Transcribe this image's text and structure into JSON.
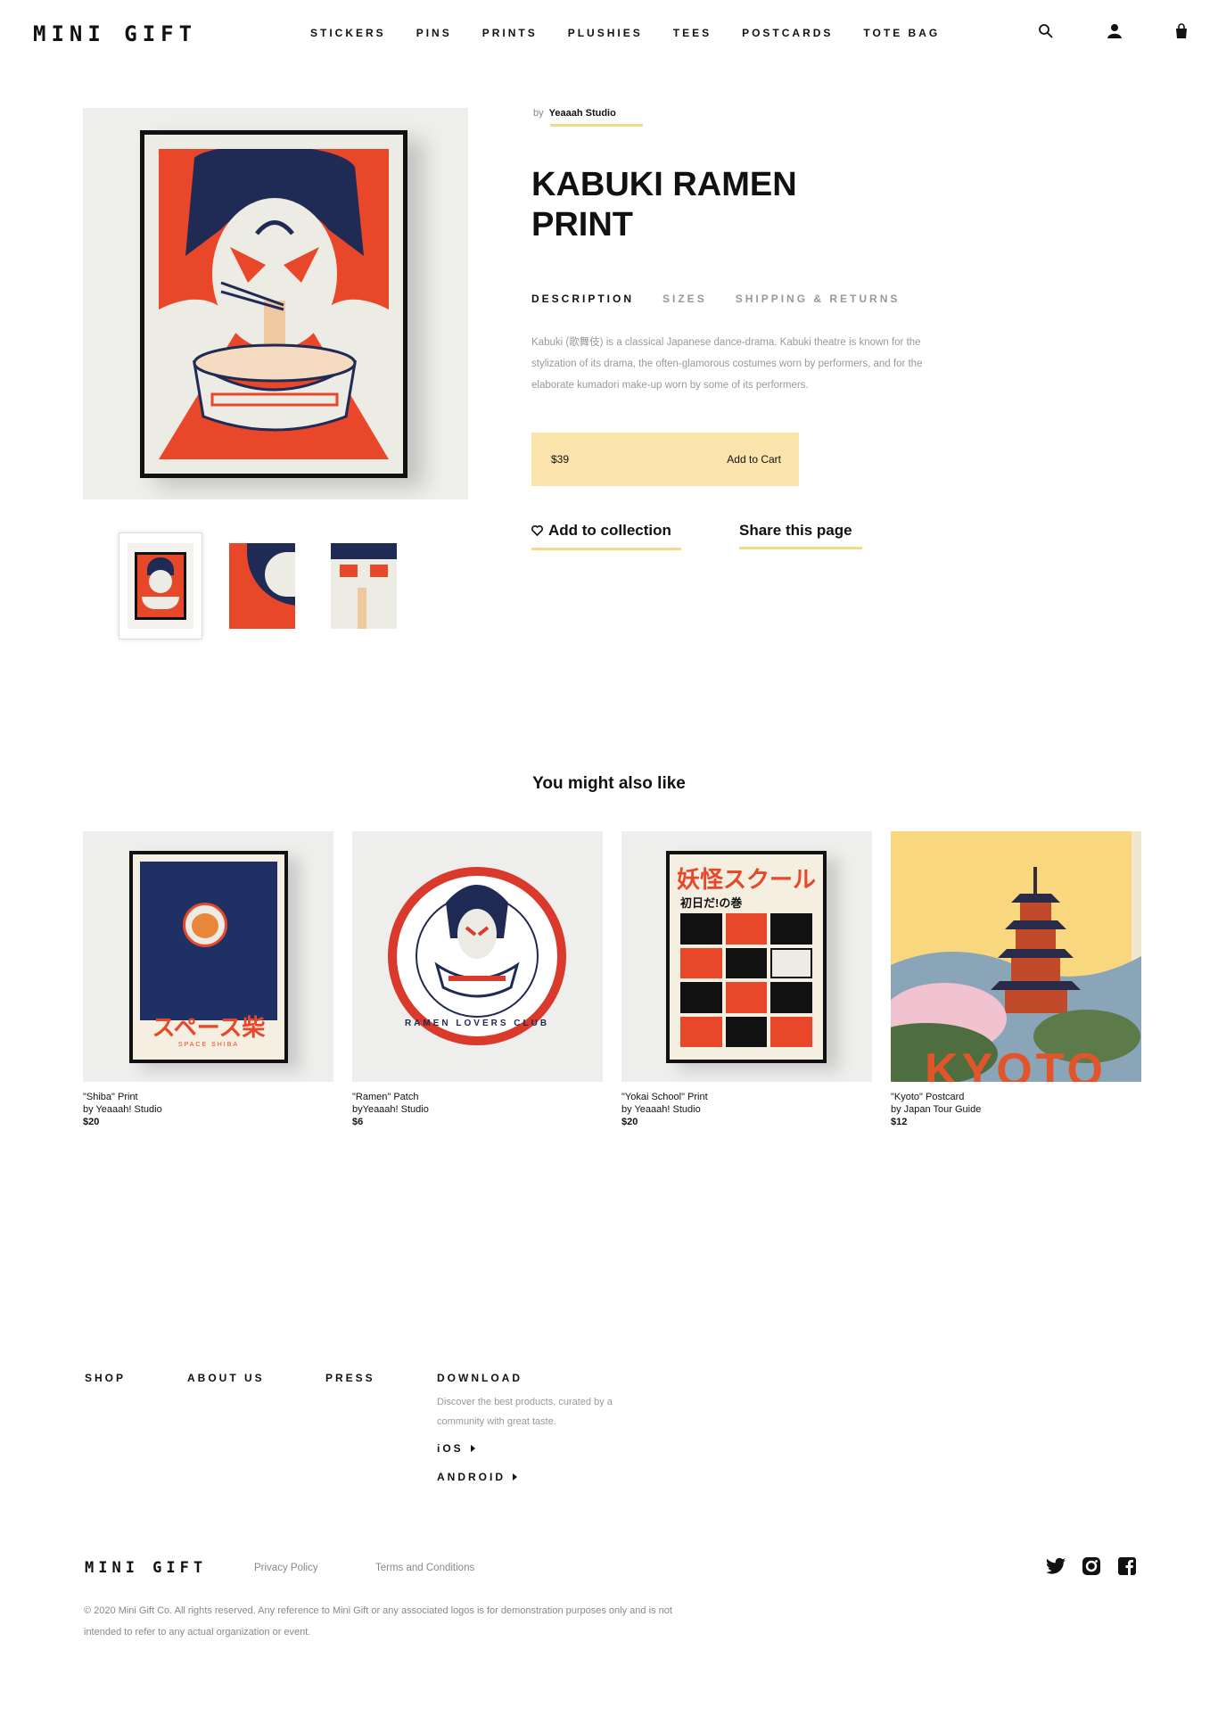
{
  "header": {
    "logo": "MINI GIFT",
    "nav": [
      "STICKERS",
      "PINS",
      "PRINTS",
      "PLUSHIES",
      "TEES",
      "POSTCARDS",
      "TOTE BAG"
    ]
  },
  "product": {
    "by_prefix": "by",
    "studio": "Yeaaah Studio",
    "title_line1": "KABUKI RAMEN",
    "title_line2": "PRINT",
    "tabs": [
      "DESCRIPTION",
      "SIZES",
      "SHIPPING & RETURNS"
    ],
    "active_tab": "DESCRIPTION",
    "description": "Kabuki (歌舞伎) is a classical Japanese dance-drama. Kabuki theatre is known for the stylization of its drama, the often-glamorous costumes worn by performers, and for the elaborate kumadori make-up worn by some of its performers.",
    "price": "$39",
    "cart_label": "Add to Cart",
    "collection_label": "Add to collection",
    "share_label": "Share this page"
  },
  "related": {
    "title": "You might also like",
    "items": [
      {
        "name": "\"Shiba\" Print",
        "by": "by Yeaaah! Studio",
        "price": "$20",
        "art_text": "スペース柴",
        "art_sub": "SPACE SHIBA"
      },
      {
        "name": "\"Ramen\" Patch",
        "by": "byYeaaah! Studio",
        "price": "$6",
        "art_text": "RAMEN LOVERS CLUB"
      },
      {
        "name": "\"Yokai School\" Print",
        "by": "by Yeaaah! Studio",
        "price": "$20",
        "art_text": "妖怪スクール",
        "art_sub": "初日だ!の巻"
      },
      {
        "name": "\"Kyoto\" Postcard",
        "by": "by Japan Tour Guide",
        "price": "$12",
        "art_text": "KYOTO"
      }
    ]
  },
  "footer": {
    "nav": [
      "SHOP",
      "ABOUT US",
      "PRESS",
      "DOWNLOAD"
    ],
    "download_desc": "Discover the best products, curated by a community with great taste.",
    "ios": "iOS",
    "android": "ANDROID",
    "logo": "MINI GIFT",
    "privacy": "Privacy Policy",
    "terms": "Terms and Conditions",
    "copyright": "© 2020 Mini Gift Co. All rights reserved. Any reference to Mini Gift or any associated logos is for demonstration purposes only and is not intended to refer to any actual organization or event."
  },
  "icons": [
    "search-icon",
    "user-icon",
    "bag-icon",
    "heart-icon",
    "twitter-icon",
    "instagram-icon",
    "facebook-icon"
  ],
  "colors": {
    "accent": "#fbe3ac",
    "underline": "#f7d98a",
    "art_red": "#e8472a",
    "art_navy": "#1f2a55"
  }
}
